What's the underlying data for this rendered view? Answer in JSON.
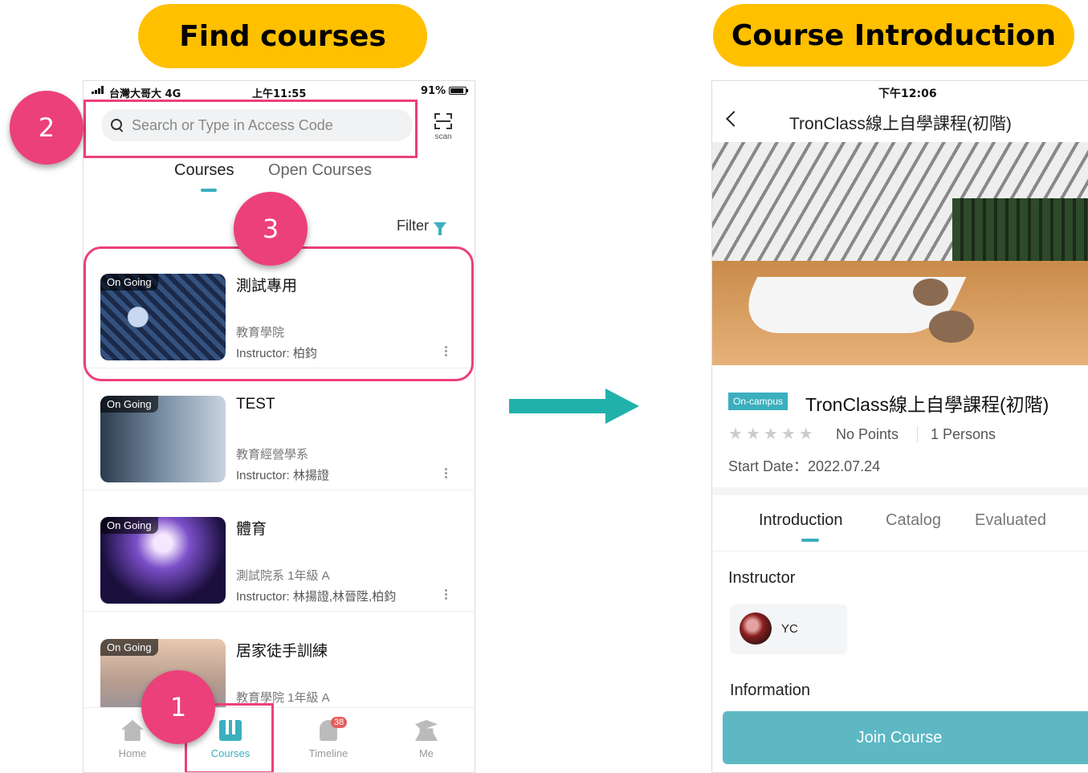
{
  "labels": {
    "left_header": "Find courses",
    "right_header": "Course Introduction"
  },
  "steps": [
    "1",
    "2",
    "3"
  ],
  "left_phone": {
    "status": {
      "carrier": "台灣大哥大  4G",
      "time": "上午11:55",
      "battery": "91%"
    },
    "search_placeholder": "Search or Type in Access Code",
    "scan_label": "scan",
    "tabs": [
      "Courses",
      "Open Courses"
    ],
    "filter_label": "Filter",
    "courses": [
      {
        "status": "On Going",
        "title": "測試專用",
        "dept": "教育學院",
        "instructor": "Instructor: 柏鈞"
      },
      {
        "status": "On Going",
        "title": "TEST",
        "dept": "教育經營學系",
        "instructor": "Instructor: 林揚證"
      },
      {
        "status": "On Going",
        "title": "體育",
        "dept": "測試院系 1年級 A",
        "instructor": "Instructor: 林揚證,林晉陞,柏鈞"
      },
      {
        "status": "On Going",
        "title": "居家徒手訓練",
        "dept": "教育學院 1年級 A",
        "instructor": ""
      }
    ],
    "nav": [
      {
        "label": "Home",
        "icon": "home-icon"
      },
      {
        "label": "Courses",
        "icon": "courses-icon"
      },
      {
        "label": "Timeline",
        "icon": "bell-icon",
        "badge": "38"
      },
      {
        "label": "Me",
        "icon": "graduate-icon"
      }
    ]
  },
  "right_phone": {
    "status_time": "下午12:06",
    "page_title": "TronClass線上自學課程(初階)",
    "badge": "On-campus",
    "course_title": "TronClass線上自學課程(初階)",
    "points": "No Points",
    "persons": "1 Persons",
    "start_date": "Start Date：2022.07.24",
    "tabs": [
      "Introduction",
      "Catalog",
      "Evaluated"
    ],
    "instructor_heading": "Instructor",
    "instructor_name": "YC",
    "information_heading": "Information",
    "join_label": "Join Course"
  },
  "colors": {
    "accent": "#3BAFBE",
    "highlight": "#EC407A",
    "pill": "#FFC000",
    "arrow": "#20B2AA"
  }
}
